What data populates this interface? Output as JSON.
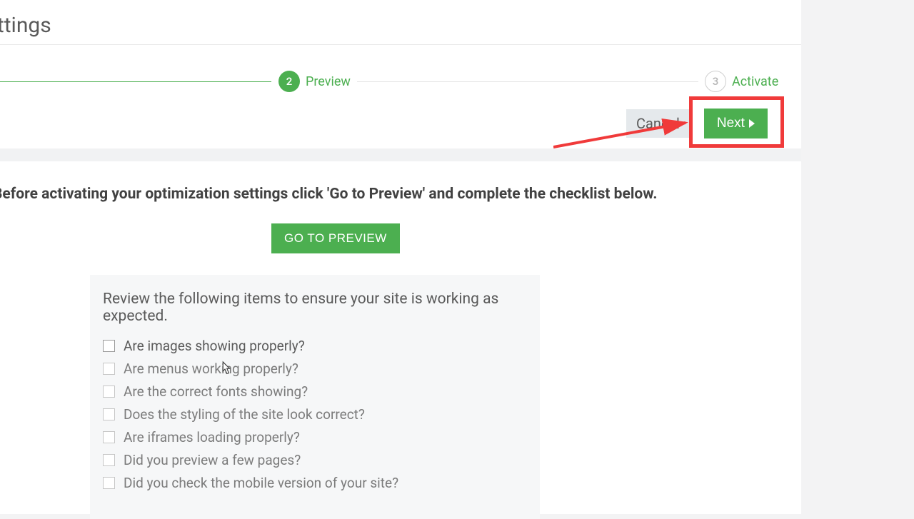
{
  "page": {
    "title": "ettings"
  },
  "stepper": {
    "step2": {
      "num": "2",
      "label": "Preview"
    },
    "step3": {
      "num": "3",
      "label": "Activate"
    }
  },
  "actions": {
    "cancel": "Cancel",
    "next": "Next"
  },
  "instructions": "Before activating your optimization settings click 'Go to Preview' and complete the checklist below.",
  "preview_button": "GO TO PREVIEW",
  "review": {
    "title": "Review the following items to ensure your site is working as expected.",
    "items": [
      "Are images showing properly?",
      "Are menus working properly?",
      "Are the correct fonts showing?",
      "Does the styling of the site look correct?",
      "Are iframes loading properly?",
      "Did you preview a few pages?",
      "Did you check the mobile version of your site?"
    ]
  },
  "annotation": {
    "highlight_color": "#f03a3a"
  }
}
